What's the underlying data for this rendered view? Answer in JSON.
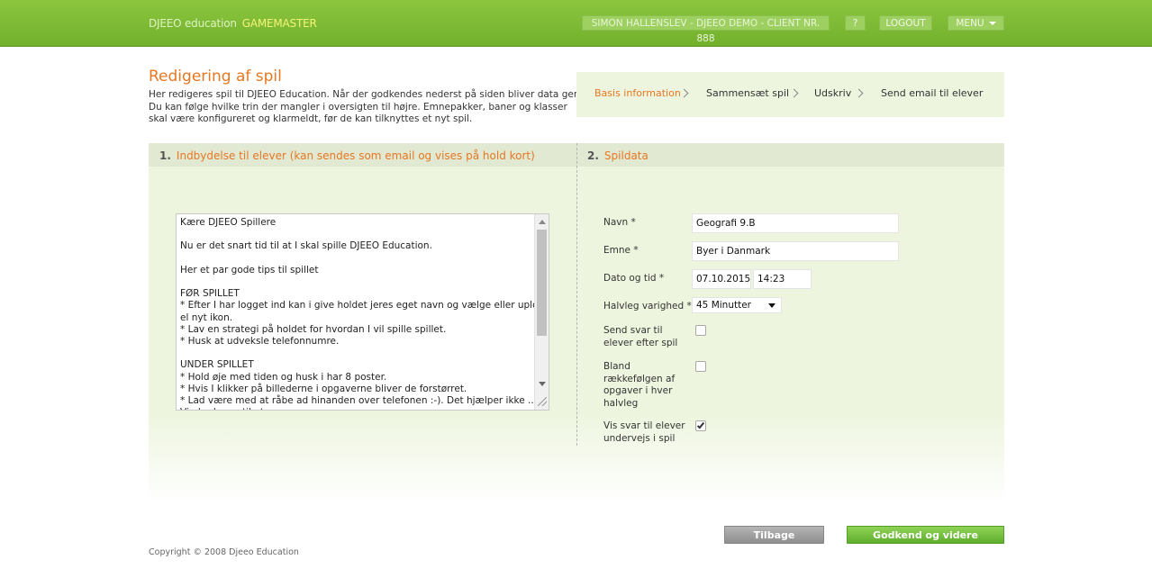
{
  "header": {
    "brand": "DJEEO education",
    "role": "GAMEMASTER",
    "user": "SIMON HALLENSLEV - DJEEO DEMO - CLIENT NR. 888",
    "help": "?",
    "logout": "LOGOUT",
    "menu": "MENU"
  },
  "page": {
    "title": "Redigering af spil",
    "intro": [
      "Her redigeres spil til DJEEO Education. Når der godkendes nederst på siden bliver data gemt.",
      "Du kan følge hvilke trin der mangler i oversigten til højre. Emnepakker, baner og klasser",
      "skal være konfigureret og klarmeldt, før de kan tilknyttes et nyt spil."
    ]
  },
  "steps": [
    "Basis information",
    "Sammensæt spil",
    "Udskriv",
    "Send email til elever"
  ],
  "section1": {
    "number": "1.",
    "title": "Indbydelse til elever (kan sendes som email og vises på hold kort)",
    "message": "Kære DJEEO Spillere\n\nNu er det snart tid til at I skal spille DJEEO Education.\n\nHer et par gode tips til spillet\n\nFØR SPILLET\n* Efter I har logget ind kan i give holdet jeres eget navn og vælge eller uploade\nel nyt ikon.\n* Lav en strategi på holdet for hvordan I vil spille spillet.\n* Husk at udveksle telefonnumre.\n\nUNDER SPILLET\n* Hold øje med tiden og husk i har 8 poster.\n* Hvis I klikker på billederne i opgaverne bliver de forstørret.\n* Lad være med at råbe ad hinanden over telefonen :-). Det hjælper ikke .....\nVi glæder os til at ..."
  },
  "section2": {
    "number": "2.",
    "title": "Spildata",
    "fields": {
      "name_label": "Navn *",
      "name_value": "Geografi 9.B",
      "subject_label": "Emne *",
      "subject_value": "Byer i Danmark",
      "datetime_label": "Dato og tid *",
      "date_value": "07.10.2015",
      "time_value": "14:23",
      "half_label": "Halvleg varighed *",
      "half_value": "45 Minutter",
      "send_answers_label": "Send svar til elever efter spil",
      "send_answers_checked": false,
      "shuffle_label": "Bland rækkefølgen af opgaver i hver halvleg",
      "shuffle_checked": false,
      "show_answers_label": "Vis svar til elever undervejs i spil",
      "show_answers_checked": true
    }
  },
  "buttons": {
    "back": "Tilbage",
    "next": "Godkend og videre"
  },
  "footer": {
    "copyright": "Copyright © 2008 Djeeo Education"
  },
  "colors": {
    "accent": "#e87722",
    "header_green": "#7cb934",
    "panel_bg": "#edf5de"
  }
}
